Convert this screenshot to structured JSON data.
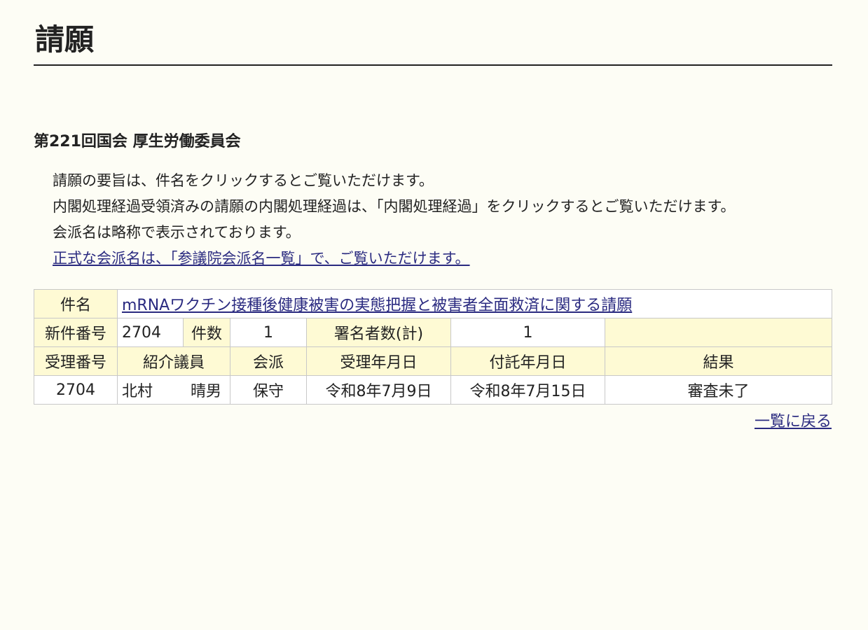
{
  "page": {
    "title": "請願"
  },
  "session": {
    "title": "第221回国会 厚生労働委員会"
  },
  "notes": {
    "line1": "請願の要旨は、件名をクリックするとご覧いただけます。",
    "line2": "内閣処理経過受領済みの請願の内閣処理経過は、「内閣処理経過」をクリックするとご覧いただけます。",
    "line3": "会派名は略称で表示されております。",
    "link": "正式な会派名は、「参議院会派名一覧」で、ご覧いただけます。"
  },
  "petition": {
    "labels": {
      "subject": "件名",
      "new_number": "新件番号",
      "count": "件数",
      "signers": "署名者数(計)",
      "receipt_number": "受理番号",
      "introducer": "紹介議員",
      "faction": "会派",
      "receipt_date": "受理年月日",
      "referral_date": "付託年月日",
      "result": "結果"
    },
    "subject": "mRNAワクチン接種後健康被害の実態把握と被害者全面救済に関する請願",
    "new_number": "2704",
    "count": "1",
    "signers": "1",
    "receipt_number": "2704",
    "introducer_family": "北村",
    "introducer_given": "晴男",
    "faction": "保守",
    "receipt_date": "令和8年7月9日",
    "referral_date": "令和8年7月15日",
    "result": "審査未了"
  },
  "footer": {
    "back_link": "一覧に戻る"
  },
  "colors": {
    "background": "#fdfdf5",
    "label_cell": "#fefad4",
    "link": "#2a2a80"
  }
}
